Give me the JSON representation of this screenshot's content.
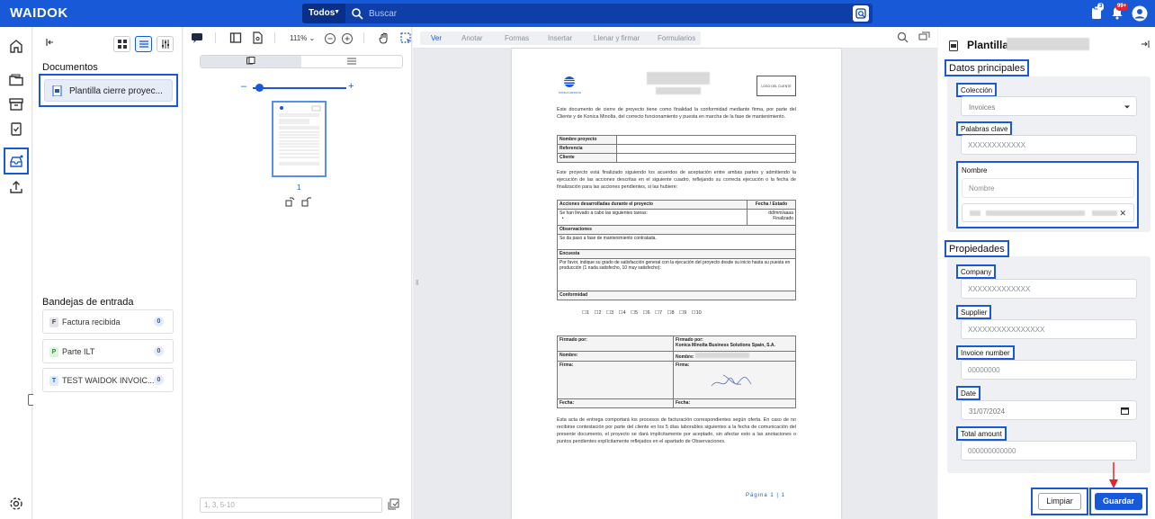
{
  "app": {
    "logo": "WAIDOK"
  },
  "search": {
    "scope": "Todos",
    "placeholder": "Buscar"
  },
  "notifications": {
    "count_a": "3",
    "count_b": "99+"
  },
  "documents_section": {
    "title": "Documentos",
    "items": [
      {
        "label": "Plantilla cierre proyec..."
      }
    ]
  },
  "inbox_section": {
    "title": "Bandejas de entrada",
    "items": [
      {
        "letter": "F",
        "label": "Factura recibida",
        "count": "0",
        "color": "#e3e5e8",
        "text": "#444"
      },
      {
        "letter": "P",
        "label": "Parte ILT",
        "count": "0",
        "color": "#dff3df",
        "text": "#2f8a3a"
      },
      {
        "letter": "T",
        "label": "TEST WAIDOK INVOIC...",
        "count": "0",
        "color": "#e1ebfb",
        "text": "#1859d8"
      }
    ]
  },
  "thumbs": {
    "zoom": "111%",
    "page_number": "1",
    "page_range_placeholder": "1, 3, 5-10"
  },
  "viewer": {
    "tabs": [
      "Ver",
      "Anotar",
      "Formas",
      "Insertar",
      "Llenar y firmar",
      "Formularios"
    ],
    "document": {
      "brand": "KONICA MINOLTA",
      "client_logo": "LOGO DEL CLIENTE",
      "intro": "Este documento de cierre de proyecto tiene como finalidad la conformidad mediante firma, por parte del Cliente y de Konica Minolta, del correcto funcionamiento y puesta en marcha de la fase de mantenimiento.",
      "info_rows": [
        "Nombre proyecto",
        "Referencia",
        "Cliente"
      ],
      "paragraph2": "Este proyecto está finalizado siguiendo los acuerdos de aceptación entre ambas partes y admitiendo la ejecución de las acciones descritas en el siguiente cuadro, reflejando su correcta ejecución o la fecha de finalización para las acciones pendientes, si las hubiere:",
      "actions_header": "Acciones desarrolladas durante el proyecto",
      "date_header": "Fecha / Estado",
      "actions_text": "Se han llevado a cabo las siguientes tareas:",
      "date_placeholder": "dd/mm/aaaa",
      "status": "Finalizado",
      "observations_header": "Observaciones",
      "observations_text": "Se da paso a fase de mantenimiento contratada.",
      "survey_header": "Encuesta",
      "survey_text": "Por favor, indique su grado de satisfacción general con la ejecución del proyecto desde su inicio hasta su puesta en producción (1 nada satisfecho, 10 muy satisfecho):",
      "survey_options": "☐1 ☐2 ☐3 ☐4 ☐5 ☐6 ☐7 ☐8 ☐9 ☐10",
      "conformity_header": "Conformidad",
      "signed_by_left": "Firmado por:",
      "signed_by_right": "Firmado por:",
      "company": "Konica Minolta Business Solutions Spain, S.A.",
      "name_label": "Nombre:",
      "signature_label": "Firma:",
      "date_label": "Fecha:",
      "closing": "Esta acta de entrega comportará los procesos de facturación correspondientes según oferta. En caso de no recibirse contestación por parte del cliente en los 5 días laborables siguientes a la fecha de comunicación del presente documento, el proyecto se dará implícitamente por aceptado, sin afectar esto a las anotaciones o puntos pendientes explícitamente reflejados en el apartado de Observaciones.",
      "footer": "Página 1 | 1"
    }
  },
  "right_panel": {
    "title": "Plantilla",
    "main_group": "Datos principales",
    "coleccion_label": "Colección",
    "coleccion_value": "Invoices",
    "palabras_label": "Palabras clave",
    "palabras_placeholder": "XXXXXXXXXXXX",
    "nombre_label": "Nombre",
    "nombre_placeholder": "Nombre",
    "props_group": "Propiedades",
    "company_label": "Company",
    "company_placeholder": "XXXXXXXXXXXXX",
    "supplier_label": "Supplier",
    "supplier_placeholder": "XXXXXXXXXXXXXXXX",
    "invoice_label": "Invoice number",
    "invoice_placeholder": "00000000",
    "date_label": "Date",
    "date_value": "31/07/2024",
    "total_label": "Total amount",
    "total_placeholder": "000000000000",
    "clear_button": "Limpiar",
    "save_button": "Guardar"
  },
  "colors": {
    "brand": "#1859d8",
    "alert": "#e3262e"
  }
}
